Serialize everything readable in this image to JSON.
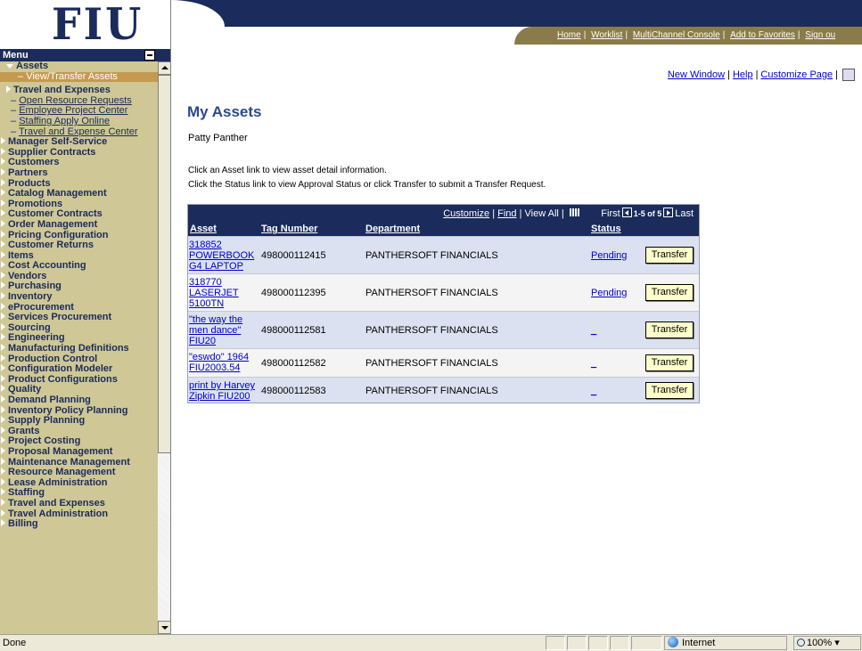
{
  "logo": {
    "text": "FIU"
  },
  "menu": {
    "title": "Menu",
    "expanded": "Assets",
    "selected": "View/Transfer Assets",
    "sub_section": "Travel and Expenses",
    "links": [
      "Open Resource Requests",
      "Employee Project Center",
      "Staffing Apply Online",
      "Travel and Expense Center"
    ],
    "items": [
      "Manager Self-Service",
      "Supplier Contracts",
      "Customers",
      "Partners",
      "Products",
      "Catalog Management",
      "Promotions",
      "Customer Contracts",
      "Order Management",
      "Pricing Configuration",
      "Customer Returns",
      "Items",
      "Cost Accounting",
      "Vendors",
      "Purchasing",
      "Inventory",
      "eProcurement",
      "Services Procurement",
      "Sourcing",
      "Engineering",
      "Manufacturing Definitions",
      "Production Control",
      "Configuration Modeler",
      "Product Configurations",
      "Quality",
      "Demand Planning",
      "Inventory Policy Planning",
      "Supply Planning",
      "Grants",
      "Project Costing",
      "Proposal Management",
      "Maintenance Management",
      "Resource Management",
      "Lease Administration",
      "Staffing",
      "Travel and Expenses",
      "Travel Administration",
      "Billing"
    ]
  },
  "header": {
    "links": [
      "Home",
      "Worklist",
      "MultiChannel Console",
      "Add to Favorites",
      "Sign ou"
    ]
  },
  "page_links": {
    "new_window": "New Window",
    "help": "Help",
    "customize": "Customize Page"
  },
  "page": {
    "title": "My Assets",
    "person": "Patty Panther",
    "instr1": "Click an Asset link to view asset detail information.",
    "instr2": "Click the Status link to view Approval Status or click Transfer to submit a Transfer Request."
  },
  "grid": {
    "customize": "Customize",
    "find": "Find",
    "view_all": "View All",
    "first": "First",
    "range": "1-5 of 5",
    "last": "Last",
    "columns": {
      "asset": "Asset",
      "tag": "Tag Number",
      "department": "Department",
      "status": "Status"
    },
    "transfer_label": "Transfer",
    "rows": [
      {
        "asset": "318852 POWERBOOK G4 LAPTOP",
        "tag": "498000112415",
        "department": "PANTHERSOFT FINANCIALS",
        "status": "Pending"
      },
      {
        "asset": "318770 LASERJET 5100TN",
        "tag": "498000112395",
        "department": "PANTHERSOFT FINANCIALS",
        "status": "Pending"
      },
      {
        "asset": "\"the way the men dance\" FIU20",
        "tag": "498000112581",
        "department": "PANTHERSOFT FINANCIALS",
        "status": "_"
      },
      {
        "asset": "\"eswdo\" 1964 FIU2003.54",
        "tag": "498000112582",
        "department": "PANTHERSOFT FINANCIALS",
        "status": "_"
      },
      {
        "asset": "print by Harvey Zipkin FIU200",
        "tag": "498000112583",
        "department": "PANTHERSOFT FINANCIALS",
        "status": "_"
      }
    ]
  },
  "statusbar": {
    "status": "Done",
    "zone": "Internet",
    "zoom": "100%"
  }
}
